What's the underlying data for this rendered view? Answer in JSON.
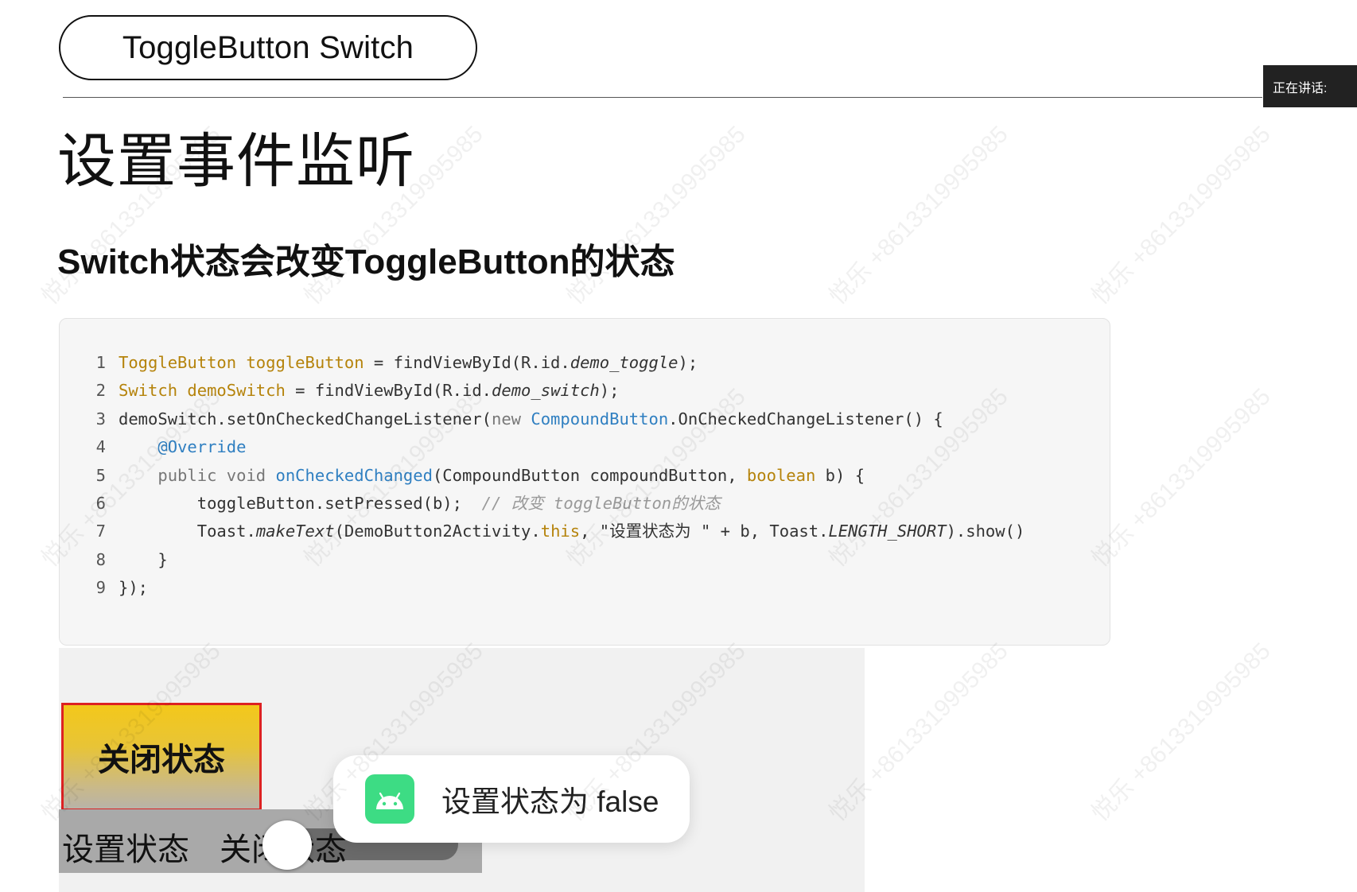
{
  "header": {
    "title": "ToggleButton Switch",
    "speaking_label": "正在讲话:"
  },
  "slide": {
    "heading": "设置事件监听",
    "subheading": "Switch状态会改变ToggleButton的状态"
  },
  "code": {
    "line_numbers": [
      "1",
      "2",
      "3",
      "4",
      "5",
      "6",
      "7",
      "8",
      "9"
    ],
    "l1": {
      "type": "ToggleButton toggleButton",
      "rest": " = findViewById(R.id.",
      "id": "demo_toggle",
      "end": ");"
    },
    "l2": {
      "type": "Switch demoSwitch",
      "rest": " = findViewById(R.id.",
      "id": "demo_switch",
      "end": ");"
    },
    "l3": {
      "start": "demoSwitch.setOnCheckedChangeListener(",
      "kw": "new",
      "space": " ",
      "cls": "CompoundButton",
      "end": ".OnCheckedChangeListener() {"
    },
    "l4": {
      "indent": "    ",
      "anno": "@Override"
    },
    "l5": {
      "indent": "    ",
      "kw": "public void",
      "space": " ",
      "method": "onCheckedChanged",
      "mid": "(CompoundButton compoundButton, ",
      "type": "boolean",
      "end": " b) {"
    },
    "l6": {
      "indent": "        ",
      "stmt": "toggleButton.setPressed(b);  ",
      "comment": "// 改变 toggleButton的状态"
    },
    "l7": {
      "indent": "        ",
      "a": "Toast.",
      "b": "makeText",
      "c": "(DemoButton2Activity.",
      "d": "this",
      "e": ", \"设置状态为 \" + b, Toast.",
      "f": "LENGTH_SHORT",
      "g": ").show()"
    },
    "l8": {
      "text": "    }"
    },
    "l9": {
      "text": "});"
    }
  },
  "demo": {
    "toggle_label": "关闭状态",
    "switch_label": "设置状态",
    "switch_state": "关闭状态",
    "toast_text": "设置状态为 false",
    "toast_icon": "android-icon"
  },
  "watermark": {
    "text": "悦乐 +8613319995985"
  },
  "colors": {
    "toggle_fill": "#f3c81b",
    "toggle_border": "#dd2222",
    "android_green": "#3ddc84",
    "code_type": "#b5830b",
    "code_method": "#2f7fc1"
  }
}
